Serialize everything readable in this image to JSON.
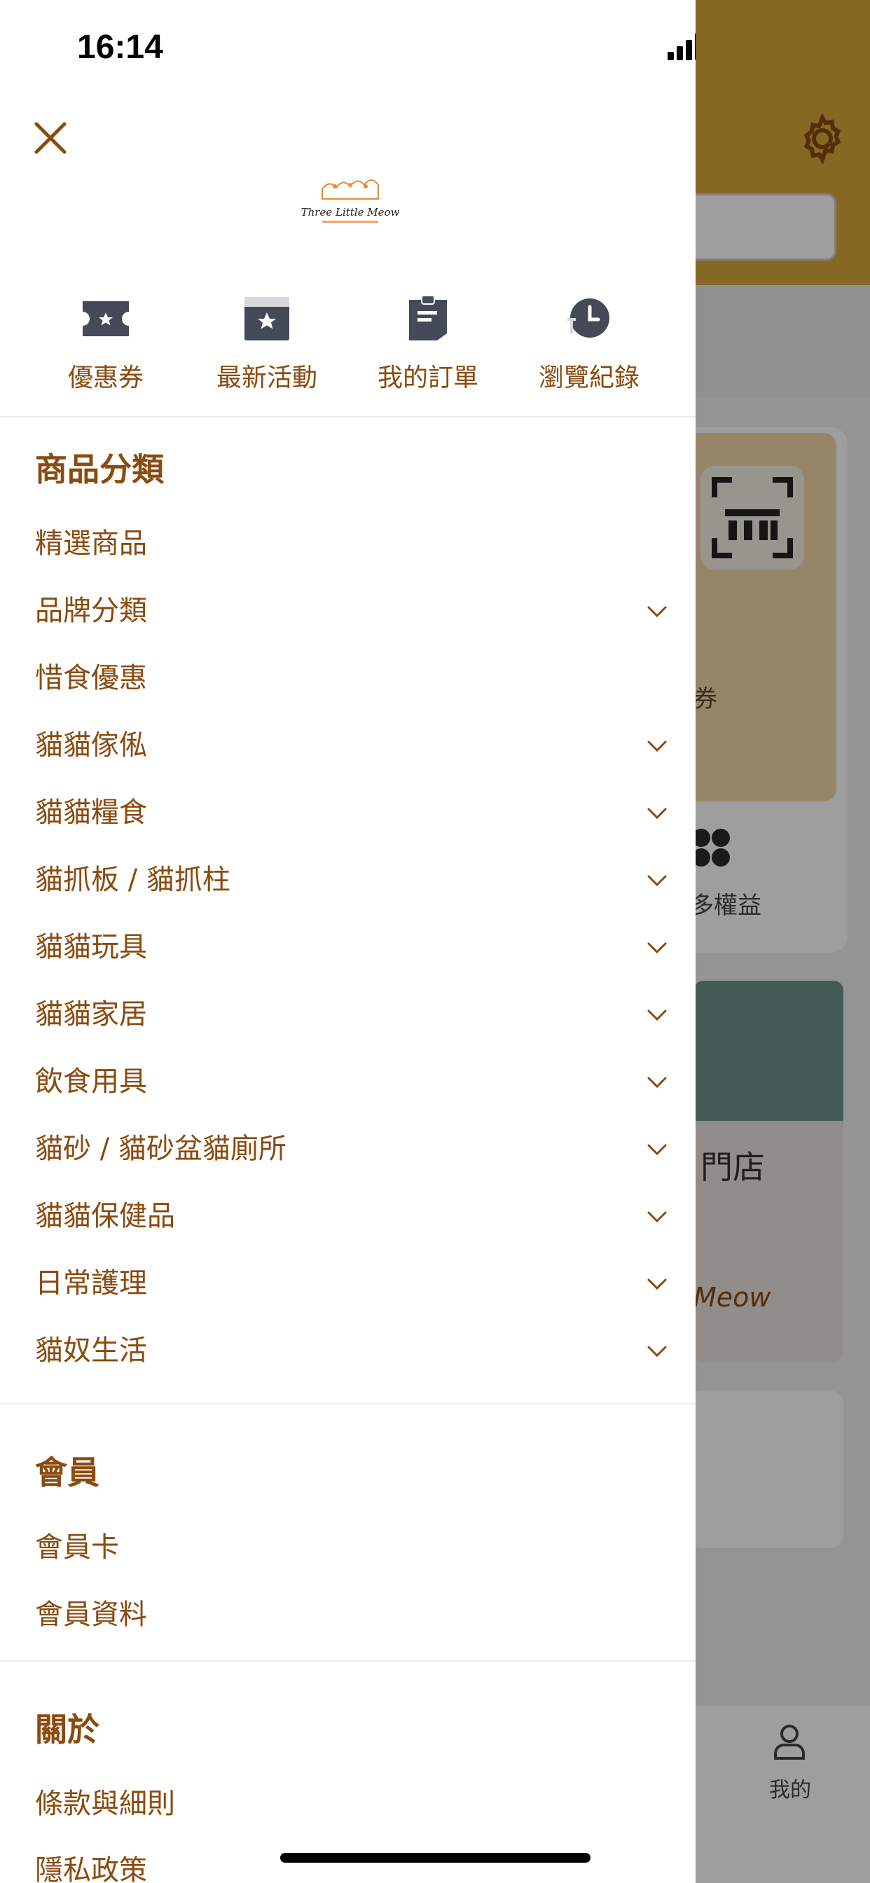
{
  "status_bar": {
    "time": "16:14"
  },
  "logo": {
    "text": "Three Little Meow"
  },
  "quick_links": [
    {
      "label": "優惠券",
      "icon": "coupon-icon"
    },
    {
      "label": "最新活動",
      "icon": "event-icon"
    },
    {
      "label": "我的訂單",
      "icon": "order-icon"
    },
    {
      "label": "瀏覽紀錄",
      "icon": "history-icon"
    }
  ],
  "categories": {
    "title": "商品分類",
    "items": [
      {
        "label": "精選商品",
        "expandable": false
      },
      {
        "label": "品牌分類",
        "expandable": true
      },
      {
        "label": "惜食優惠",
        "expandable": false
      },
      {
        "label": "貓貓傢俬",
        "expandable": true
      },
      {
        "label": "貓貓糧食",
        "expandable": true
      },
      {
        "label": "貓抓板 / 貓抓柱",
        "expandable": true
      },
      {
        "label": "貓貓玩具",
        "expandable": true
      },
      {
        "label": "貓貓家居",
        "expandable": true
      },
      {
        "label": "飲食用具",
        "expandable": true
      },
      {
        "label": "貓砂 / 貓砂盆貓廁所",
        "expandable": true
      },
      {
        "label": "貓貓保健品",
        "expandable": true
      },
      {
        "label": "日常護理",
        "expandable": true
      },
      {
        "label": "貓奴生活",
        "expandable": true
      }
    ]
  },
  "member": {
    "title": "會員",
    "items": [
      {
        "label": "會員卡"
      },
      {
        "label": "會員資料"
      }
    ]
  },
  "about": {
    "title": "關於",
    "items": [
      {
        "label": "條款與細則"
      },
      {
        "label": "隱私政策"
      }
    ]
  },
  "background": {
    "coupon_text": "券",
    "more_text": "多權益",
    "banner_text": "門店",
    "banner_brand": "Meow",
    "tab_me": "我的"
  },
  "colors": {
    "accent": "#8a4b0f",
    "header_yellow": "#d9a73a",
    "divider": "#ececec",
    "icon_gray": "#454a59"
  }
}
